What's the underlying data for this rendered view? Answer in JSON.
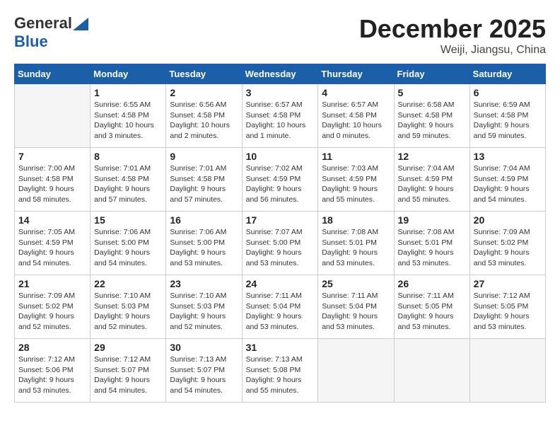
{
  "header": {
    "logo_general": "General",
    "logo_blue": "Blue",
    "month_title": "December 2025",
    "location": "Weiji, Jiangsu, China"
  },
  "days_of_week": [
    "Sunday",
    "Monday",
    "Tuesday",
    "Wednesday",
    "Thursday",
    "Friday",
    "Saturday"
  ],
  "weeks": [
    [
      {
        "day": "",
        "info": ""
      },
      {
        "day": "1",
        "info": "Sunrise: 6:55 AM\nSunset: 4:58 PM\nDaylight: 10 hours\nand 3 minutes."
      },
      {
        "day": "2",
        "info": "Sunrise: 6:56 AM\nSunset: 4:58 PM\nDaylight: 10 hours\nand 2 minutes."
      },
      {
        "day": "3",
        "info": "Sunrise: 6:57 AM\nSunset: 4:58 PM\nDaylight: 10 hours\nand 1 minute."
      },
      {
        "day": "4",
        "info": "Sunrise: 6:57 AM\nSunset: 4:58 PM\nDaylight: 10 hours\nand 0 minutes."
      },
      {
        "day": "5",
        "info": "Sunrise: 6:58 AM\nSunset: 4:58 PM\nDaylight: 9 hours\nand 59 minutes."
      },
      {
        "day": "6",
        "info": "Sunrise: 6:59 AM\nSunset: 4:58 PM\nDaylight: 9 hours\nand 59 minutes."
      }
    ],
    [
      {
        "day": "7",
        "info": "Sunrise: 7:00 AM\nSunset: 4:58 PM\nDaylight: 9 hours\nand 58 minutes."
      },
      {
        "day": "8",
        "info": "Sunrise: 7:01 AM\nSunset: 4:58 PM\nDaylight: 9 hours\nand 57 minutes."
      },
      {
        "day": "9",
        "info": "Sunrise: 7:01 AM\nSunset: 4:58 PM\nDaylight: 9 hours\nand 57 minutes."
      },
      {
        "day": "10",
        "info": "Sunrise: 7:02 AM\nSunset: 4:59 PM\nDaylight: 9 hours\nand 56 minutes."
      },
      {
        "day": "11",
        "info": "Sunrise: 7:03 AM\nSunset: 4:59 PM\nDaylight: 9 hours\nand 55 minutes."
      },
      {
        "day": "12",
        "info": "Sunrise: 7:04 AM\nSunset: 4:59 PM\nDaylight: 9 hours\nand 55 minutes."
      },
      {
        "day": "13",
        "info": "Sunrise: 7:04 AM\nSunset: 4:59 PM\nDaylight: 9 hours\nand 54 minutes."
      }
    ],
    [
      {
        "day": "14",
        "info": "Sunrise: 7:05 AM\nSunset: 4:59 PM\nDaylight: 9 hours\nand 54 minutes."
      },
      {
        "day": "15",
        "info": "Sunrise: 7:06 AM\nSunset: 5:00 PM\nDaylight: 9 hours\nand 54 minutes."
      },
      {
        "day": "16",
        "info": "Sunrise: 7:06 AM\nSunset: 5:00 PM\nDaylight: 9 hours\nand 53 minutes."
      },
      {
        "day": "17",
        "info": "Sunrise: 7:07 AM\nSunset: 5:00 PM\nDaylight: 9 hours\nand 53 minutes."
      },
      {
        "day": "18",
        "info": "Sunrise: 7:08 AM\nSunset: 5:01 PM\nDaylight: 9 hours\nand 53 minutes."
      },
      {
        "day": "19",
        "info": "Sunrise: 7:08 AM\nSunset: 5:01 PM\nDaylight: 9 hours\nand 53 minutes."
      },
      {
        "day": "20",
        "info": "Sunrise: 7:09 AM\nSunset: 5:02 PM\nDaylight: 9 hours\nand 53 minutes."
      }
    ],
    [
      {
        "day": "21",
        "info": "Sunrise: 7:09 AM\nSunset: 5:02 PM\nDaylight: 9 hours\nand 52 minutes."
      },
      {
        "day": "22",
        "info": "Sunrise: 7:10 AM\nSunset: 5:03 PM\nDaylight: 9 hours\nand 52 minutes."
      },
      {
        "day": "23",
        "info": "Sunrise: 7:10 AM\nSunset: 5:03 PM\nDaylight: 9 hours\nand 52 minutes."
      },
      {
        "day": "24",
        "info": "Sunrise: 7:11 AM\nSunset: 5:04 PM\nDaylight: 9 hours\nand 53 minutes."
      },
      {
        "day": "25",
        "info": "Sunrise: 7:11 AM\nSunset: 5:04 PM\nDaylight: 9 hours\nand 53 minutes."
      },
      {
        "day": "26",
        "info": "Sunrise: 7:11 AM\nSunset: 5:05 PM\nDaylight: 9 hours\nand 53 minutes."
      },
      {
        "day": "27",
        "info": "Sunrise: 7:12 AM\nSunset: 5:05 PM\nDaylight: 9 hours\nand 53 minutes."
      }
    ],
    [
      {
        "day": "28",
        "info": "Sunrise: 7:12 AM\nSunset: 5:06 PM\nDaylight: 9 hours\nand 53 minutes."
      },
      {
        "day": "29",
        "info": "Sunrise: 7:12 AM\nSunset: 5:07 PM\nDaylight: 9 hours\nand 54 minutes."
      },
      {
        "day": "30",
        "info": "Sunrise: 7:13 AM\nSunset: 5:07 PM\nDaylight: 9 hours\nand 54 minutes."
      },
      {
        "day": "31",
        "info": "Sunrise: 7:13 AM\nSunset: 5:08 PM\nDaylight: 9 hours\nand 55 minutes."
      },
      {
        "day": "",
        "info": ""
      },
      {
        "day": "",
        "info": ""
      },
      {
        "day": "",
        "info": ""
      }
    ]
  ]
}
